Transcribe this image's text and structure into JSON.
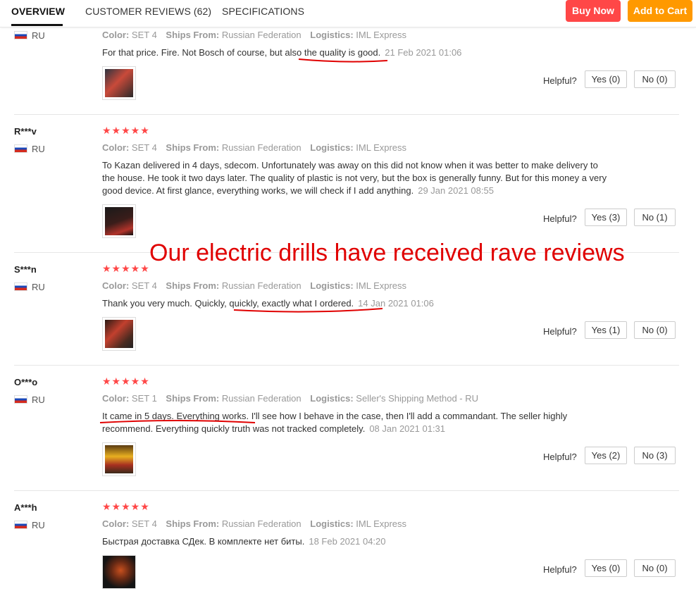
{
  "tabs": {
    "overview": "OVERVIEW",
    "reviews": "CUSTOMER REVIEWS (62)",
    "specs": "SPECIFICATIONS"
  },
  "actions": {
    "buy_now": "Buy Now",
    "add_to_cart": "Add to Cart"
  },
  "labels": {
    "color": "Color:",
    "ships_from": "Ships From:",
    "logistics": "Logistics:",
    "helpful": "Helpful?"
  },
  "overlay_text": "Our electric drills have received rave reviews",
  "reviews": [
    {
      "user": "",
      "country": "RU",
      "stars": "★★★★★",
      "color": "SET 4",
      "ships_from": "Russian Federation",
      "logistics": "IML Express",
      "text": "For that price. Fire. Not Bosch of course, but also the quality is good.",
      "date": "21 Feb 2021 01:06",
      "yes": "Yes (0)",
      "no": "No (0)"
    },
    {
      "user": "R***v",
      "country": "RU",
      "stars": "★★★★★",
      "color": "SET 4",
      "ships_from": "Russian Federation",
      "logistics": "IML Express",
      "text": "To Kazan delivered in 4 days, sdecom. Unfortunately was away on this did not know when it was better to make delivery to the house. He took it two days later. The quality of plastic is not very, but the box is generally funny. But for this money a very good device. At first glance, everything works, we will check if I add anything.",
      "date": "29 Jan 2021 08:55",
      "yes": "Yes (3)",
      "no": "No (1)"
    },
    {
      "user": "S***n",
      "country": "RU",
      "stars": "★★★★★",
      "color": "SET 4",
      "ships_from": "Russian Federation",
      "logistics": "IML Express",
      "text": "Thank you very much. Quickly, quickly, exactly what I ordered.",
      "date": "14 Jan 2021 01:06",
      "yes": "Yes (1)",
      "no": "No (0)"
    },
    {
      "user": "O***o",
      "country": "RU",
      "stars": "★★★★★",
      "color": "SET 1",
      "ships_from": "Russian Federation",
      "logistics": "Seller's Shipping Method - RU",
      "text": "It came in 5 days. Everything works. I'll see how I behave in the case, then I'll add a commandant. The seller highly recommend. Everything quickly truth was not tracked completely.",
      "date": "08 Jan 2021 01:31",
      "yes": "Yes (2)",
      "no": "No (3)"
    },
    {
      "user": "A***h",
      "country": "RU",
      "stars": "★★★★★",
      "color": "SET 4",
      "ships_from": "Russian Federation",
      "logistics": "IML Express",
      "text": "Быстрая доставка СДек. В комплекте нет биты.",
      "date": "18 Feb 2021 04:20",
      "yes": "Yes (0)",
      "no": "No (0)"
    }
  ],
  "colors": {
    "accent_red": "#ff4747",
    "accent_orange": "#ff9900",
    "annotation_red": "#e00000"
  }
}
